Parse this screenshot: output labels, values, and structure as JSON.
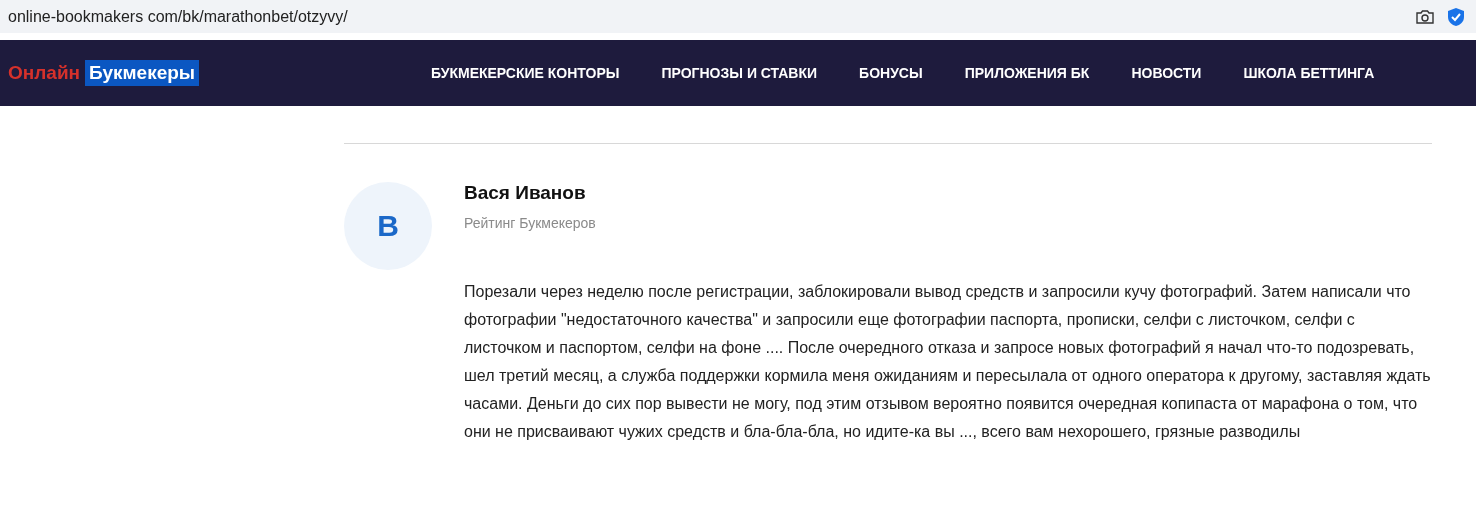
{
  "address_bar": {
    "url": "online-bookmakers com/bk/marathonbet/otzyvy/"
  },
  "header": {
    "logo": {
      "first": "Онлайн",
      "second": "Букмекеры"
    },
    "nav": [
      {
        "label": "БУКМЕКЕРСКИЕ КОНТОРЫ"
      },
      {
        "label": "ПРОГНОЗЫ И СТАВКИ"
      },
      {
        "label": "БОНУСЫ"
      },
      {
        "label": "ПРИЛОЖЕНИЯ БК"
      },
      {
        "label": "НОВОСТИ"
      },
      {
        "label": "ШКОЛА БЕТТИНГА"
      }
    ]
  },
  "review": {
    "avatar_letter": "В",
    "author": "Вася Иванов",
    "source": "Рейтинг Букмекеров",
    "text": "Порезали через неделю после регистрации, заблокировали вывод средств и запросили кучу фотографий. Затем написали что фотографии \"недостаточного качества\" и запросили еще фотографии паспорта, прописки, селфи с листочком, селфи с листочком и паспортом, селфи на фоне .... После очередного отказа и запросе новых фотографий я начал что-то подозревать, шел третий месяц, а служба поддержки кормила меня ожиданиям и пересылала от одного оператора к другому, заставляя ждать часами. Деньги до сих пор вывести не могу, под этим отзывом вероятно появится очередная копипаста от марафона о том, что они не присваивают чужих средств и бла-бла-бла, но идите-ка вы ..., всего вам нехорошего, грязные разводилы"
  }
}
